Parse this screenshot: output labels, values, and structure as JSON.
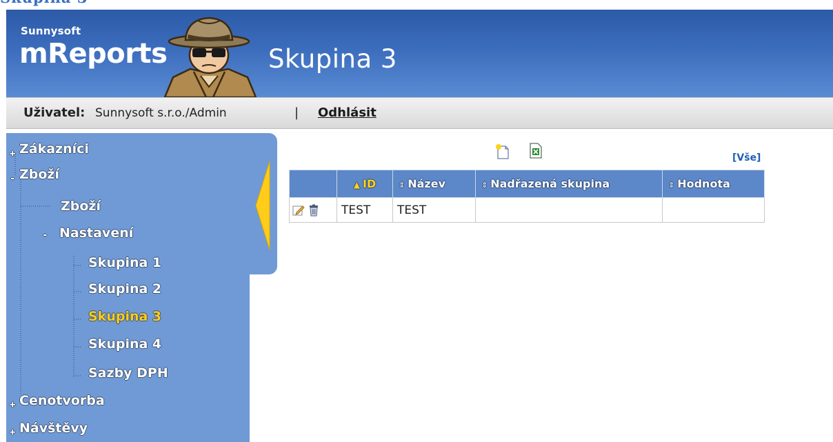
{
  "page_top_title": "Skupina 3",
  "header": {
    "brand_small": "Sunnysoft",
    "brand_big": "mReports",
    "page_title": "Skupina 3",
    "header_color": "#3c6dbd"
  },
  "userbar": {
    "user_label": "Uživatel:",
    "user_value": "Sunnysoft s.r.o./Admin",
    "separator": "|",
    "logout_label": "Odhlásit"
  },
  "sidebar": {
    "color": "#6f9ad6",
    "items": [
      {
        "label": "Zákazníci",
        "expander": "+"
      },
      {
        "label": "Zboží",
        "expander": "-"
      },
      {
        "label": "Zboží"
      },
      {
        "label": "Nastavení",
        "expander": "-"
      },
      {
        "label": "Skupina 1"
      },
      {
        "label": "Skupina 2"
      },
      {
        "label": "Skupina 3",
        "selected": true
      },
      {
        "label": "Skupina 4"
      },
      {
        "label": "Sazby DPH"
      },
      {
        "label": "Cenotvorba",
        "expander": "+"
      },
      {
        "label": "Návštěvy",
        "expander": "+"
      }
    ],
    "toggle_icon": "collapse-arrow-icon"
  },
  "toolbar": {
    "new_icon": "new-document-icon",
    "excel_icon": "excel-export-icon",
    "all_link": "[Vše]"
  },
  "grid": {
    "columns": [
      {
        "label": "",
        "sort": "none"
      },
      {
        "label": "ID",
        "sort": "asc"
      },
      {
        "label": "Název",
        "sort": "sortable"
      },
      {
        "label": "Nadřazená skupina",
        "sort": "sortable"
      },
      {
        "label": "Hodnota",
        "sort": "sortable"
      }
    ],
    "rows": [
      {
        "edit_icon": "edit-icon",
        "delete_icon": "trash-icon",
        "id": "TEST",
        "nazev": "TEST",
        "nadrazena": "",
        "hodnota": ""
      }
    ]
  }
}
